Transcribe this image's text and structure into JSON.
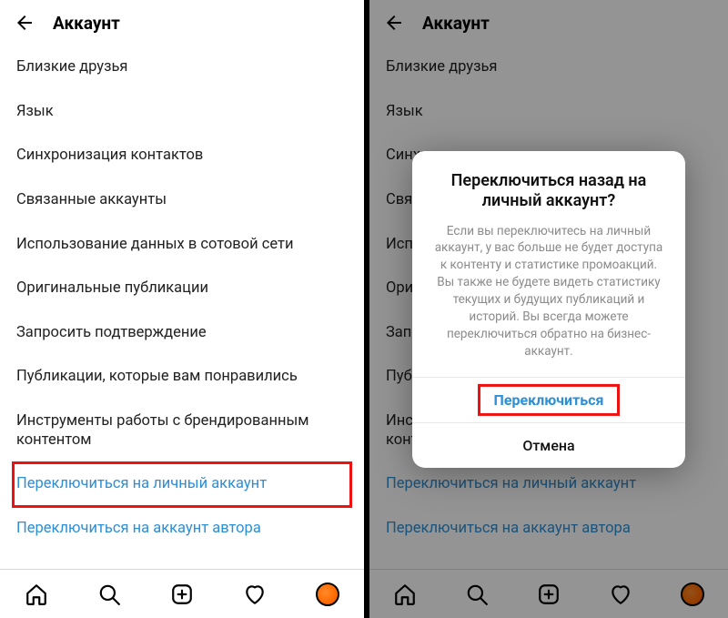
{
  "left": {
    "header": {
      "title": "Аккаунт"
    },
    "items": [
      "Близкие друзья",
      "Язык",
      "Синхронизация контактов",
      "Связанные аккаунты",
      "Использование данных в сотовой сети",
      "Оригинальные публикации",
      "Запросить подтверждение",
      "Публикации, которые вам понравились",
      "Инструменты работы с брендированным контентом",
      "Переключиться на личный аккаунт",
      "Переключиться на аккаунт автора"
    ]
  },
  "right": {
    "header": {
      "title": "Аккаунт"
    },
    "items": [
      "Близкие друзья",
      "Язык",
      "Синхронизация контактов",
      "Связанные аккаунты",
      "Использование данных в сотовой сети",
      "Оригинальные публикации",
      "Запросить подтверждение",
      "Публикации, которые вам понравились",
      "Инструменты работы с брендированным контентом",
      "Переключиться на личный аккаунт",
      "Переключиться на аккаунт автора"
    ],
    "modal": {
      "title": "Переключиться назад на личный аккаунт?",
      "body": "Если вы переключитесь на личный аккаунт, у вас больше не будет доступа к контенту и статистике промоакций. Вы также не будете видеть статистику текущих и будущих публикаций и историй. Вы всегда можете переключиться обратно на бизнес-аккаунт.",
      "primary": "Переключиться",
      "cancel": "Отмена"
    }
  }
}
